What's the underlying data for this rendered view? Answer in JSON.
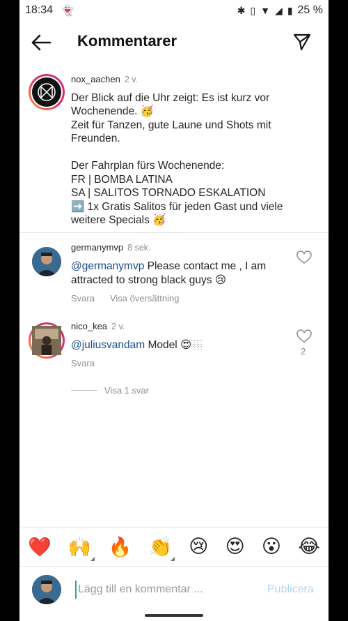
{
  "status_bar": {
    "time": "18:34",
    "battery": "25 %"
  },
  "header": {
    "title": "Kommentarer"
  },
  "caption": {
    "username": "nox_aachen",
    "age": "2 v.",
    "text": "Der Blick auf die Uhr zeigt: Es ist kurz vor Wochenende. 🥳\nZeit für Tanzen, gute Laune und Shots mit Freunden.\n\nDer Fahrplan fürs Wochenende:\nFR | BOMBA LATINA\nSA | SALITOS TORNADO ESKALATION\n➡️ 1x Gratis Salitos für jeden Gast und viele weitere Specials 🥳"
  },
  "comments": [
    {
      "username": "germanymvp",
      "age": "8 sek.",
      "mention": "@germanymvp",
      "text": " Please contact me , I am attracted to strong black guys 😢",
      "reply_label": "Svara",
      "translate_label": "Visa översättning"
    },
    {
      "username": "nico_kea",
      "age": "2 v.",
      "mention": "@juliusvandam",
      "text": " Model 😍🏼",
      "reply_label": "Svara",
      "likes": "2"
    }
  ],
  "show_replies": "Visa 1 svar",
  "emoji_bar": [
    "❤️",
    "🙌",
    "🔥",
    "👏",
    "😢",
    "😍",
    "😮",
    "😂"
  ],
  "input": {
    "placeholder": "Lägg till en kommentar ...",
    "publish_label": "Publicera"
  }
}
